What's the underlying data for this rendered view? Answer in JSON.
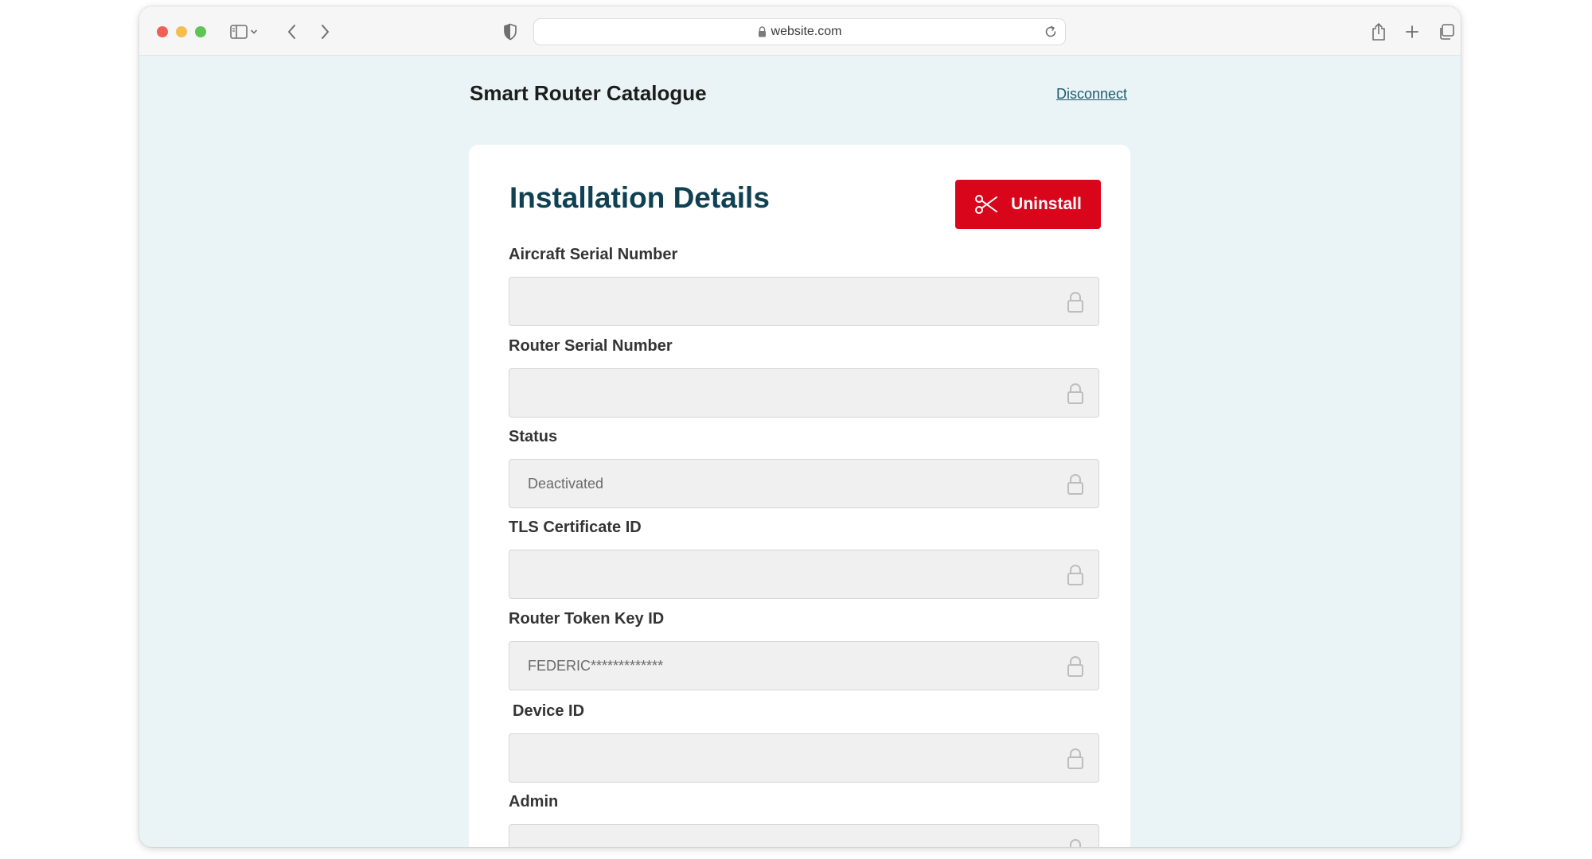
{
  "browser": {
    "url": "website.com",
    "icons": {
      "sidebar": "sidebar-icon",
      "sidebar_chevron": "chevron-down-icon",
      "back": "back-icon",
      "forward": "forward-icon",
      "privacy": "shield-icon",
      "lock": "lock-icon",
      "reload": "reload-icon",
      "share": "share-icon",
      "new_tab": "plus-icon",
      "tabs": "tabs-overview-icon"
    }
  },
  "header": {
    "app_title": "Smart Router Catalogue",
    "disconnect_label": "Disconnect"
  },
  "card": {
    "title": "Installation Details",
    "uninstall_label": "Uninstall",
    "uninstall_icon": "scissors-icon",
    "fields": [
      {
        "label": "Aircraft Serial Number",
        "value": ""
      },
      {
        "label": "Router Serial Number",
        "value": ""
      },
      {
        "label": "Status",
        "value": "Deactivated"
      },
      {
        "label": "TLS Certificate ID",
        "value": ""
      },
      {
        "label": "Router Token Key ID",
        "value": "FEDERIC*************"
      },
      {
        "label": "Device ID",
        "value": ""
      },
      {
        "label": "Admin",
        "value": ""
      }
    ]
  },
  "colors": {
    "page_background": "#eaf4f6",
    "title": "#0f4152",
    "uninstall_button": "#d8051b",
    "link": "#1d5c6e",
    "field_background": "#f0f0f0"
  }
}
